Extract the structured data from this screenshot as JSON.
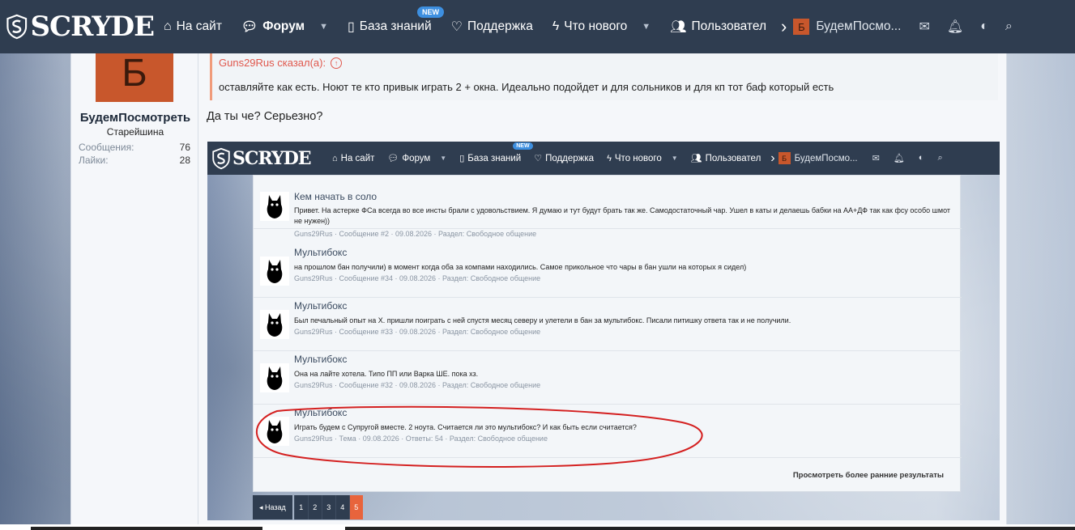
{
  "nav": {
    "logo": "SCRYDE",
    "items": [
      {
        "label": "На сайт",
        "icon": "home-icon"
      },
      {
        "label": "Форум",
        "icon": "chat-icon"
      },
      {
        "label": "База знаний",
        "icon": "book-icon"
      },
      {
        "label": "Поддержка",
        "icon": "heart-icon"
      },
      {
        "label": "Что нового",
        "icon": "bolt-icon"
      },
      {
        "label": "Пользовател",
        "icon": "users-icon"
      }
    ],
    "new_badge": "NEW",
    "user_initial": "Б",
    "user_name": "БудемПосмо..."
  },
  "author": {
    "initial": "Б",
    "name": "БудемПосмотреть",
    "rank": "Старейшина",
    "messages_label": "Сообщения:",
    "messages": "76",
    "likes_label": "Лайки:",
    "likes": "28"
  },
  "post": {
    "quote_author": "Guns29Rus сказал(а):",
    "quote_text": "оставляйте как есть. Ноют те кто привык играть 2 + окна. Идеально подойдет и для сольников и для кп тот баф который есть",
    "reply": "Да ты че? Серьезно?"
  },
  "shot": {
    "logo": "SCRYDE",
    "nav_items": [
      "На сайт",
      "Форум",
      "База знаний",
      "Поддержка",
      "Что нового",
      "Пользовател"
    ],
    "new_badge": "NEW",
    "user_initial": "Б",
    "user_name": "БудемПосмо...",
    "results": [
      {
        "title": "Кем начать в соло",
        "snippet": "Привет. На астерке ФСа всегда во все инсты брали с удовольствием. Я думаю и тут будут брать так же. Самодостаточный чар. Ушел в каты и делаешь бабки на АА+ДФ так как фсу особо шмот не нужен))",
        "meta": "Guns29Rus · Сообщение #2 · 09.08.2026 · Раздел: Свободное общение"
      },
      {
        "title": "Мультибокс",
        "snippet": "на прошлом бан получили) в момент когда оба за компами находились. Самое прикольное что чары в бан ушли на которых я сидел)",
        "meta": "Guns29Rus · Сообщение #34 · 09.08.2026 · Раздел: Свободное общение"
      },
      {
        "title": "Мультибокс",
        "snippet": "Был печальный опыт на Х. пришли поиграть с ней спустя месяц северу и улетели в бан за мультибокс. Писали питишку ответа так и не получили.",
        "meta": "Guns29Rus · Сообщение #33 · 09.08.2026 · Раздел: Свободное общение"
      },
      {
        "title": "Мультибокс",
        "snippet": "Она на лайте хотела. Типо ПП или Варка ШЕ. пока хз.",
        "meta": "Guns29Rus · Сообщение #32 · 09.08.2026 · Раздел: Свободное общение"
      },
      {
        "title": "Мультибокс",
        "snippet": "Играть будем с Супругой вместе. 2 ноута. Считается ли это мультибокс? И как быть если считается?",
        "meta": "Guns29Rus · Тема · 09.08.2026 · Ответы: 54 · Раздел: Свободное общение"
      }
    ],
    "more": "Просмотреть более ранние результаты",
    "pager": {
      "back": "◂ Назад",
      "pages": [
        "1",
        "2",
        "3",
        "4",
        "5"
      ],
      "active": "5"
    }
  },
  "colors": {
    "nav": "#2f3d50",
    "accent": "#c8572c",
    "active_page": "#e8643c",
    "annotation": "#d42020"
  }
}
